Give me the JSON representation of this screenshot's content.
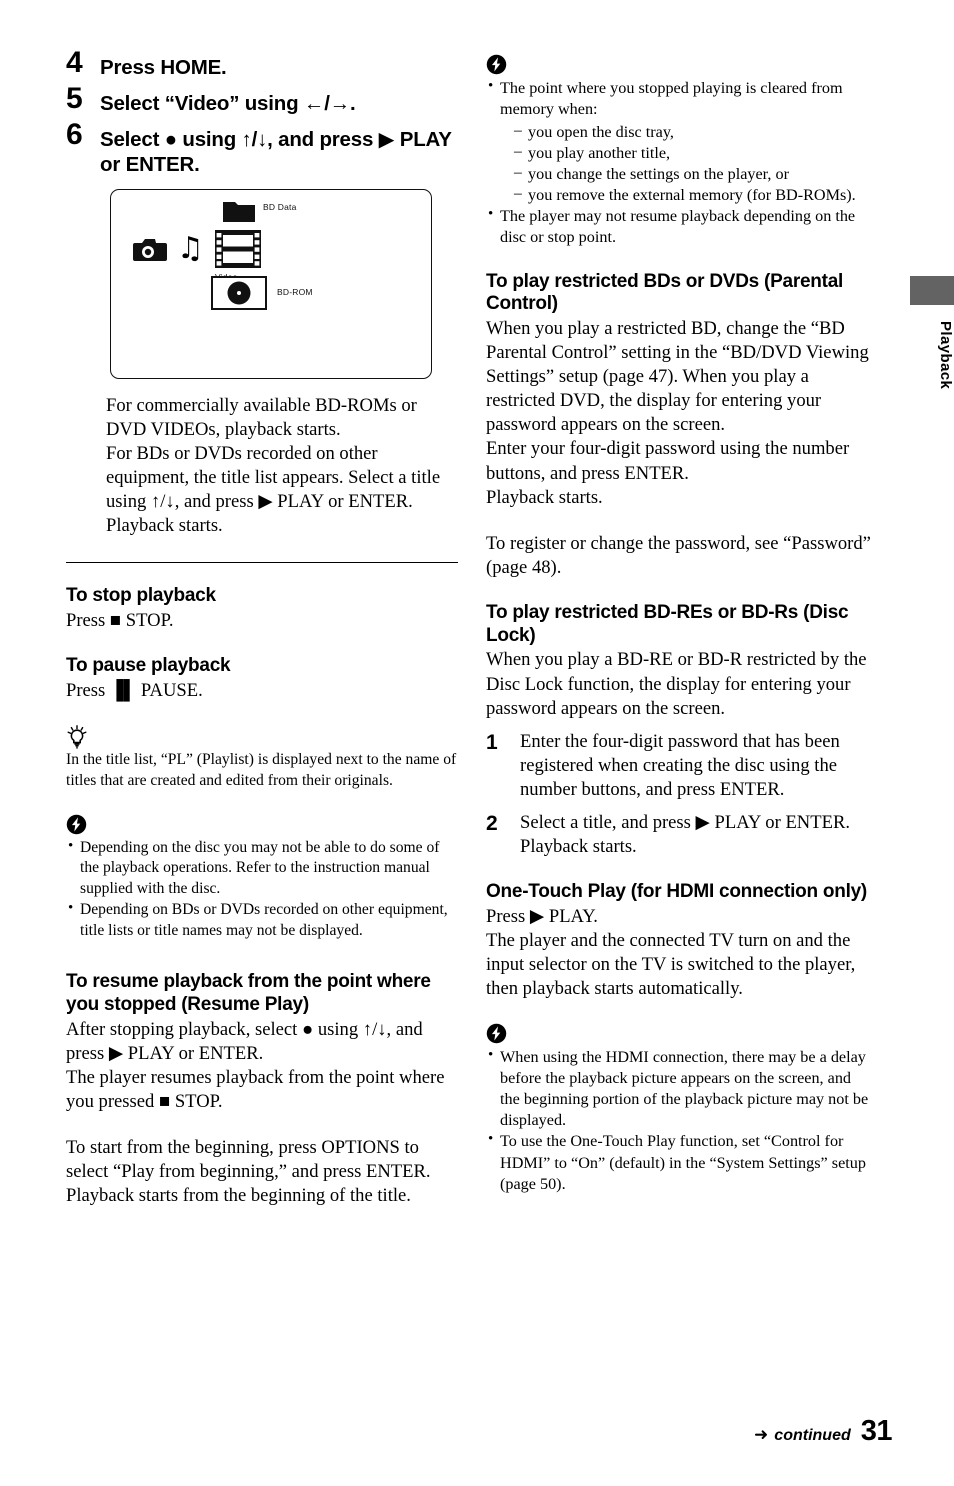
{
  "steps": [
    {
      "num": "4",
      "text": "Press HOME."
    },
    {
      "num": "5",
      "text": "Select “Video” using ←/→."
    },
    {
      "num": "6",
      "text": "Select ● using ↑/↓, and press ▶ PLAY or ENTER."
    }
  ],
  "illustration": {
    "labels": {
      "bd_data": "BD Data",
      "video": "Video",
      "bd_rom": "BD-ROM"
    },
    "icons": [
      "camera-icon",
      "music-note-icon",
      "film-strip-icon",
      "folder-icon",
      "disc-icon"
    ]
  },
  "left": {
    "intro_para": "For commercially available BD-ROMs or DVD VIDEOs, playback starts.",
    "intro_para2": "For BDs or DVDs recorded on other equipment, the title list appears. Select a title using ↑/↓, and press ▶ PLAY or ENTER.",
    "intro_para3": "Playback starts.",
    "stop_heading": "To stop playback",
    "stop_body": "Press ■ STOP.",
    "pause_heading": "To pause playback",
    "pause_body": "Press ▐▌ PAUSE.",
    "tip_text": "In the title list, “PL” (Playlist) is displayed next to the name of titles that are created and edited from their originals.",
    "notes": [
      "Depending on the disc you may not be able to do some of the playback operations. Refer to the instruction manual supplied with the disc.",
      "Depending on BDs or DVDs recorded on other equipment, title lists or title names may not be displayed."
    ],
    "resume_heading": "To resume playback from the point where you stopped (Resume Play)",
    "resume_body1": "After stopping playback, select ● using ↑/↓, and press ▶ PLAY or ENTER.",
    "resume_body2": "The player resumes playback from the point where you pressed ■ STOP.",
    "resume_body3": "To start from the beginning, press OPTIONS to select “Play from beginning,” and press ENTER. Playback starts from the beginning of the title."
  },
  "right": {
    "notes_top_lead": "The point where you stopped playing is cleared from memory when:",
    "notes_top_sub": [
      "you open the disc tray,",
      "you play another title,",
      "you change the settings on the player, or",
      "you remove the external memory (for BD-ROMs)."
    ],
    "notes_top_second": "The player may not resume playback depending on the disc or stop point.",
    "parental_heading": "To play restricted BDs or DVDs (Parental Control)",
    "parental_body1": "When you play a restricted BD, change the “BD Parental Control” setting in the “BD/DVD Viewing Settings” setup (page 47). When you play a restricted DVD, the display for entering your password appears on the screen.",
    "parental_body2": "Enter your four-digit password using the number buttons, and press ENTER.",
    "parental_body3": "Playback starts.",
    "password_note": "To register or change the password, see “Password” (page 48).",
    "disclock_heading": "To play restricted BD-REs or BD-Rs (Disc Lock)",
    "disclock_body": "When you play a BD-RE or BD-R restricted by the Disc Lock function, the display for entering your password appears on the screen.",
    "disclock_steps": [
      {
        "num": "1",
        "text": "Enter the four-digit password that has been registered when creating the disc using the number buttons, and press ENTER."
      },
      {
        "num": "2",
        "text": "Select a title, and press ▶ PLAY or ENTER."
      }
    ],
    "disclock_step2_extra": "Playback starts.",
    "onetouch_heading": "One-Touch Play (for HDMI connection only)",
    "onetouch_body1": "Press ▶ PLAY.",
    "onetouch_body2": "The player and the connected TV turn on and the input selector on the TV is switched to the player, then playback starts automatically.",
    "onetouch_notes": [
      "When using the HDMI connection, there may be a delay before the playback picture appears on the screen, and the beginning portion of the playback picture may not be displayed.",
      "To use the One-Touch Play function, set “Control for HDMI” to “On” (default) in the “System Settings” setup (page 50)."
    ]
  },
  "tab": {
    "label": "Playback",
    "color": "#636363"
  },
  "footer": {
    "continued": "continued",
    "page": "31"
  }
}
